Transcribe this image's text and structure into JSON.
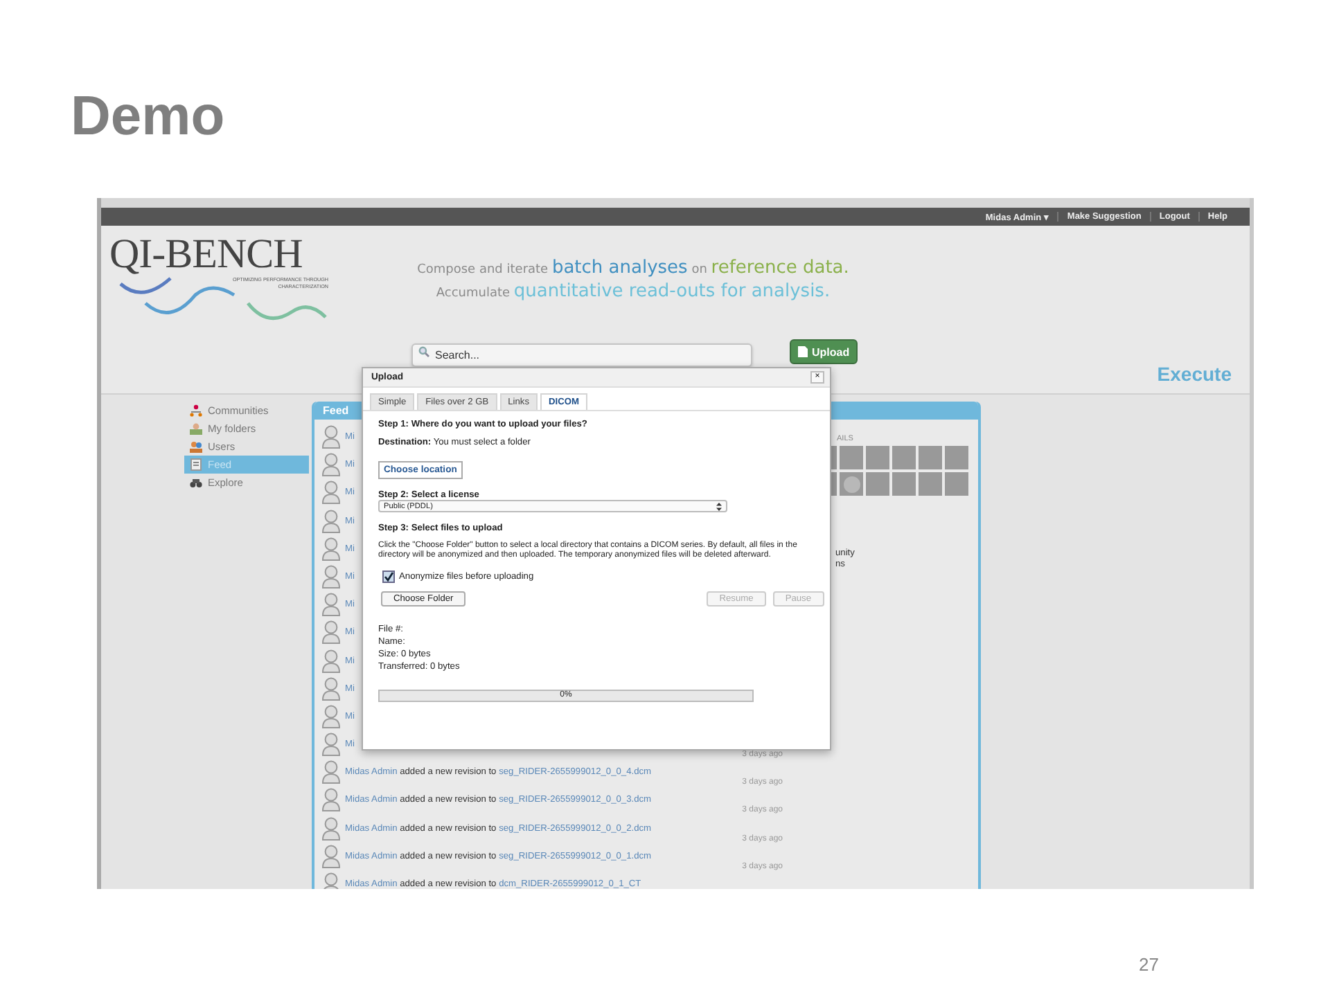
{
  "slide": {
    "title": "Demo",
    "page_number": "27"
  },
  "nav": {
    "user": "Midas Admin",
    "caret": "▾",
    "links": [
      "Make Suggestion",
      "Logout",
      "Help"
    ]
  },
  "logo": {
    "name": "QI-BENCH",
    "subtitle": [
      "OPTIMIZING PERFORMANCE THROUGH",
      "CHARACTERIZATION"
    ]
  },
  "tagline": [
    [
      {
        "text": "Compose and iterate ",
        "kind": "plain"
      },
      {
        "text": "batch analyses",
        "kind": "blue"
      },
      {
        "text": " on ",
        "kind": "plain"
      },
      {
        "text": "reference data.",
        "kind": "green"
      }
    ],
    [
      {
        "text": "Accumulate ",
        "kind": "plain"
      },
      {
        "text": "quantitative read-outs for analysis.",
        "kind": "cyan"
      }
    ]
  ],
  "search": {
    "placeholder": "Search..."
  },
  "upload_button": "Upload",
  "section_title": "Execute",
  "sidebar": [
    {
      "label": "Communities",
      "selected": false
    },
    {
      "label": "My folders",
      "selected": false
    },
    {
      "label": "Users",
      "selected": false
    },
    {
      "label": "Feed",
      "selected": true
    },
    {
      "label": "Explore",
      "selected": false
    }
  ],
  "feed": {
    "title": "Feed",
    "entries": [
      {
        "author": "Mi"
      },
      {
        "author": "Mi"
      },
      {
        "author": "Mi"
      },
      {
        "author": "Mi"
      },
      {
        "author": "Mi"
      },
      {
        "author": "Mi"
      },
      {
        "author": "Mi"
      },
      {
        "author": "Mi"
      },
      {
        "author": "Mi"
      },
      {
        "author": "Mi"
      },
      {
        "author": "Mi"
      },
      {
        "author": "Mi",
        "time": "3 days ago"
      },
      {
        "author": "Midas Admin",
        "action": "added a new revision to",
        "target": "seg_RIDER-2655999012_0_0_4.dcm",
        "time": "3 days ago"
      },
      {
        "author": "Midas Admin",
        "action": "added a new revision to",
        "target": "seg_RIDER-2655999012_0_0_3.dcm",
        "time": "3 days ago"
      },
      {
        "author": "Midas Admin",
        "action": "added a new revision to",
        "target": "seg_RIDER-2655999012_0_0_2.dcm",
        "time": "3 days ago"
      },
      {
        "author": "Midas Admin",
        "action": "added a new revision to",
        "target": "seg_RIDER-2655999012_0_0_1.dcm",
        "time": "3 days ago"
      },
      {
        "author": "Midas Admin",
        "action": "added a new revision to",
        "target": "dcm_RIDER-2655999012_0_1_CT"
      }
    ]
  },
  "details": {
    "heading": "AILS",
    "texts": [
      "unity",
      "ns"
    ]
  },
  "dialog": {
    "title": "Upload",
    "close": "×",
    "tabs": [
      {
        "label": "Simple",
        "selected": false
      },
      {
        "label": "Files over 2 GB",
        "selected": false
      },
      {
        "label": "Links",
        "selected": false
      },
      {
        "label": "DICOM",
        "selected": true
      }
    ],
    "step1": "Step 1: Where do you want to upload your files?",
    "destination": "**Destination:** You must select a folder",
    "choose_location": "Choose location",
    "step2": "Step 2: Select a license",
    "license": "Public (PDDL)",
    "step3": "Step 3: Select files to upload",
    "instructions": "Click the \"Choose Folder\" button to select a local directory that contains a DICOM series. By default, all files in the directory will be anonymized and then uploaded. The temporary anonymized files will be deleted afterward.",
    "anonymize": {
      "label": "Anonymize files before uploading",
      "checked": true
    },
    "buttons": [
      {
        "label": "Choose Folder",
        "disabled": false
      },
      {
        "label": "Resume",
        "disabled": true
      },
      {
        "label": "Pause",
        "disabled": true
      }
    ],
    "file_info": [
      "File #:",
      "Name:",
      "Size: 0 bytes",
      "Transferred: 0 bytes"
    ],
    "progress": {
      "level": 0,
      "reading": "0%"
    }
  }
}
